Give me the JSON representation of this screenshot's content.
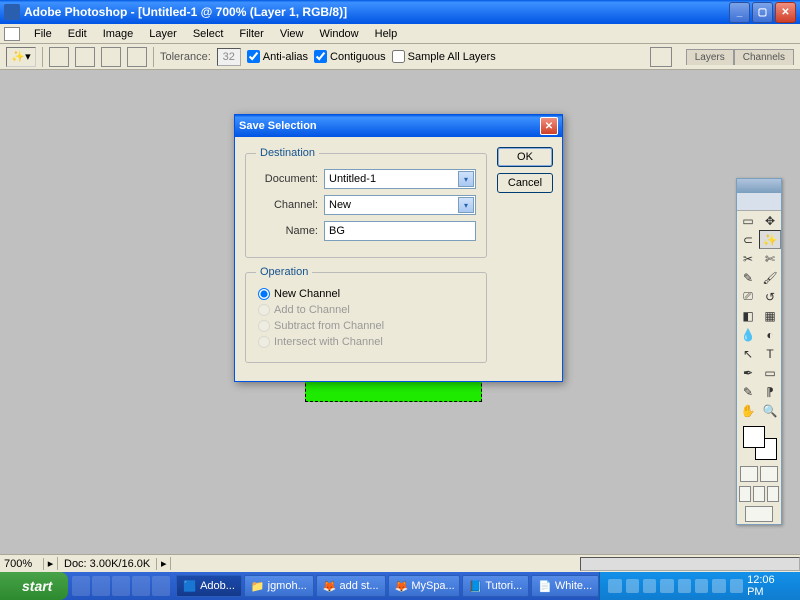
{
  "app": {
    "title": "Adobe Photoshop - [Untitled-1 @ 700% (Layer 1, RGB/8)]"
  },
  "menu": {
    "items": [
      "File",
      "Edit",
      "Image",
      "Layer",
      "Select",
      "Filter",
      "View",
      "Window",
      "Help"
    ]
  },
  "options": {
    "tolerance_label": "Tolerance:",
    "tolerance_value": "32",
    "antialias": "Anti-alias",
    "contiguous": "Contiguous",
    "sample_all": "Sample All Layers",
    "panel_tabs": [
      "Layers",
      "Channels"
    ]
  },
  "dialog": {
    "title": "Save Selection",
    "ok": "OK",
    "cancel": "Cancel",
    "dest_legend": "Destination",
    "doc_label": "Document:",
    "doc_value": "Untitled-1",
    "chan_label": "Channel:",
    "chan_value": "New",
    "name_label": "Name:",
    "name_value": "BG",
    "op_legend": "Operation",
    "op_new": "New Channel",
    "op_add": "Add to Channel",
    "op_sub": "Subtract from Channel",
    "op_int": "Intersect with Channel"
  },
  "status": {
    "zoom": "700%",
    "doc": "Doc: 3.00K/16.0K"
  },
  "taskbar": {
    "start": "start",
    "tasks": [
      "Adob...",
      "jgmoh...",
      "add st...",
      "MySpa...",
      "Tutori...",
      "White..."
    ],
    "clock": "12:06 PM"
  },
  "tools": {
    "glyphs": [
      "▭",
      "▶",
      "⊡",
      "✛",
      "◢",
      "✄",
      "✎",
      "▧",
      "⌫",
      "◐",
      "▤",
      "▼",
      "⎚",
      "◧",
      "◑",
      "△",
      "◉",
      "✐",
      "↖",
      "T",
      "✦",
      "▭",
      "↗",
      "◔",
      "✋",
      "�魚",
      "⤢",
      "⚲"
    ]
  }
}
